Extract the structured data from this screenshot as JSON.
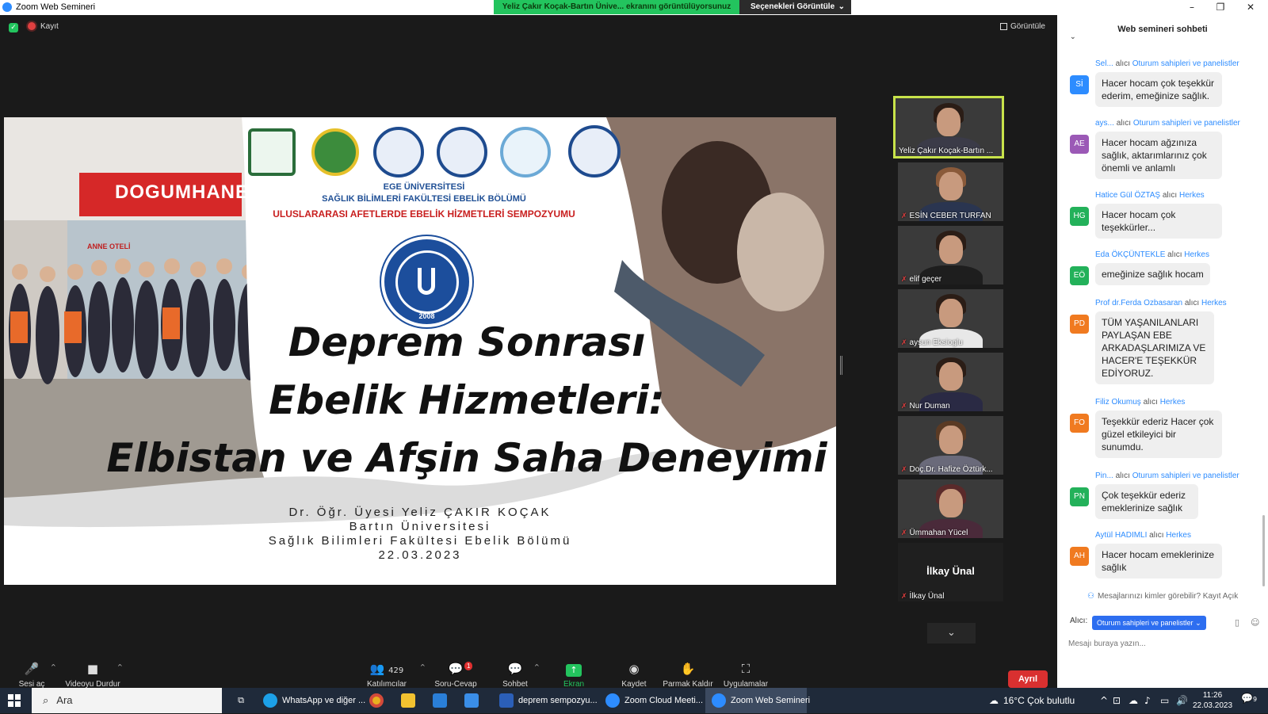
{
  "window": {
    "title": "Zoom Web Semineri",
    "share_banner": "Yeliz Çakır Koçak-Bartın Ünive... ekranını görüntülüyorsunuz",
    "view_options": "Seçenekleri Görüntüle",
    "controls": {
      "minimize": "–",
      "restore": "❐",
      "close": "✕"
    }
  },
  "meeting": {
    "recording_label": "Kayıt",
    "view_label": "Görüntüle"
  },
  "slide": {
    "univ_line1": "EGE ÜNİVERSİTESİ",
    "univ_line2": "SAĞLIK BİLİMLERİ FAKÜLTESİ EBELİK BÖLÜMÜ",
    "symposium": "ULUSLARARASI AFETLERDE EBELİK HİZMETLERİ SEMPOZYUMU",
    "sign_dogumhane": "DOGUMHANE",
    "sign_anne_oteli": "ANNE OTELİ",
    "seal_year": "2008",
    "title_line1": "Deprem Sonrası",
    "title_line2": "Ebelik Hizmetleri:",
    "title_line3": "Elbistan ve Afşin Saha Deneyimi",
    "author": "Dr. Öğr. Üyesi Yeliz ÇAKIR KOÇAK",
    "affiliation1": "Bartın Üniversitesi",
    "affiliation2": "Sağlık Bilimleri Fakültesi Ebelik Bölümü",
    "date": "22.03.2023"
  },
  "gallery": {
    "participants": [
      {
        "name": "Yeliz Çakır Koçak-Bartın ..."
      },
      {
        "name": "ESİN CEBER TURFAN"
      },
      {
        "name": "elif geçer"
      },
      {
        "name": "aysun Eksioglu"
      },
      {
        "name": "Nur Duman"
      },
      {
        "name": "Doç.Dr. Hafize Öztürk..."
      },
      {
        "name": "Ümmahan Yücel"
      },
      {
        "name": "İlkay Ünal",
        "display": "İlkay Ünal"
      }
    ],
    "scroll_icon": "chevron-down"
  },
  "toolbar": {
    "unmute": "Sesi aç",
    "stop_video": "Videoyu Durdur",
    "participants": "Katılımcılar",
    "participant_count": "429",
    "qa": "Soru-Cevap",
    "qa_badge": "1",
    "chat": "Sohbet",
    "share_screen": "Ekran Paylaşımı",
    "record": "Kaydet",
    "raise_hand": "Parmak Kaldır",
    "apps": "Uygulamalar",
    "leave": "Ayrıl"
  },
  "chat": {
    "title": "Web semineri sohbeti",
    "messages": [
      {
        "sender": "Sel...",
        "to_word": "alıcı",
        "to": "Oturum sahipleri ve panelistler",
        "initials": "Sİ",
        "color": "#2d8cff",
        "text": "Hacer hocam çok teşekkür ederim, emeğinize sağlık."
      },
      {
        "sender": "ays...",
        "to_word": "alıcı",
        "to": "Oturum sahipleri ve panelistler",
        "initials": "AE",
        "color": "#9b59b6",
        "text": "Hacer hocam ağzınıza sağlık, aktarımlarınız çok önemli ve anlamlı"
      },
      {
        "sender": "Hatice Gül ÖZTAŞ",
        "to_word": "alıcı",
        "to": "Herkes",
        "initials": "HG",
        "color": "#23b15a",
        "text": "Hacer hocam  çok teşekkürler..."
      },
      {
        "sender": "Eda ÖKÇÜNTEKLE",
        "to_word": "alıcı",
        "to": "Herkes",
        "initials": "EÖ",
        "color": "#23b15a",
        "text": "emeğinize sağlık hocam"
      },
      {
        "sender": "Prof dr.Ferda Ozbasaran",
        "to_word": "alıcı",
        "to": "Herkes",
        "initials": "PD",
        "color": "#f07a20",
        "text": "TÜM YAŞANILANLARI PAYLAŞAN EBE ARKADAŞLARIMIZA VE HACER'E TEŞEKKÜR EDİYORUZ."
      },
      {
        "sender": "Filiz Okumuş",
        "to_word": "alıcı",
        "to": "Herkes",
        "initials": "FO",
        "color": "#f07a20",
        "text": "Teşekkür ederiz Hacer çok güzel etkileyici bir sunumdu."
      },
      {
        "sender": "Pin...",
        "to_word": "alıcı",
        "to": "Oturum sahipleri ve panelistler",
        "initials": "PN",
        "color": "#23b15a",
        "text": "Çok teşekkür ederiz emeklerinize sağlık"
      },
      {
        "sender": "Aytül HADIMLI",
        "to_word": "alıcı",
        "to": "Herkes",
        "initials": "AH",
        "color": "#f07a20",
        "text": "Hacer hocam emeklerinize sağlık"
      }
    ],
    "privacy_note": "Mesajlarınızı kimler görebilir? Kayıt Açık",
    "recipient_label": "Alıcı:",
    "recipient_value": "Oturum sahipleri ve panelistler",
    "input_placeholder": "Mesajı buraya yazın..."
  },
  "taskbar": {
    "search_placeholder": "Ara",
    "apps": [
      {
        "label": "WhatsApp ve diğer ..."
      },
      {
        "label": "deprem sempozyu..."
      },
      {
        "label": "Zoom Cloud Meeti..."
      },
      {
        "label": "Zoom Web Semineri"
      }
    ],
    "weather": "16°C  Çok bulutlu",
    "time": "11:26",
    "date": "22.03.2023",
    "notification_count": "9"
  }
}
